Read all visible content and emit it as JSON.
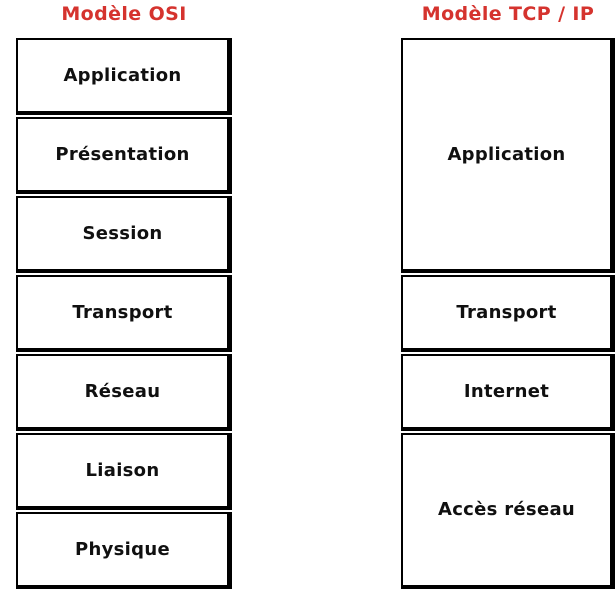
{
  "diagram": {
    "type": "layered-comparison",
    "background_color": "#ffffff",
    "title_color": "#d5332e",
    "box_border_color": "#000000",
    "box_fill_color": "#ffffff",
    "label_color": "#101010"
  },
  "columns": [
    {
      "id": "osi",
      "title": "Modèle OSI",
      "layers": [
        {
          "label": "Application",
          "span": 1
        },
        {
          "label": "Présentation",
          "span": 1
        },
        {
          "label": "Session",
          "span": 1
        },
        {
          "label": "Transport",
          "span": 1
        },
        {
          "label": "Réseau",
          "span": 1
        },
        {
          "label": "Liaison",
          "span": 1
        },
        {
          "label": "Physique",
          "span": 1
        }
      ]
    },
    {
      "id": "tcpip",
      "title": "Modèle TCP / IP",
      "layers": [
        {
          "label": "Application",
          "span": 3
        },
        {
          "label": "Transport",
          "span": 1
        },
        {
          "label": "Internet",
          "span": 1
        },
        {
          "label": "Accès réseau",
          "span": 2
        }
      ]
    }
  ]
}
